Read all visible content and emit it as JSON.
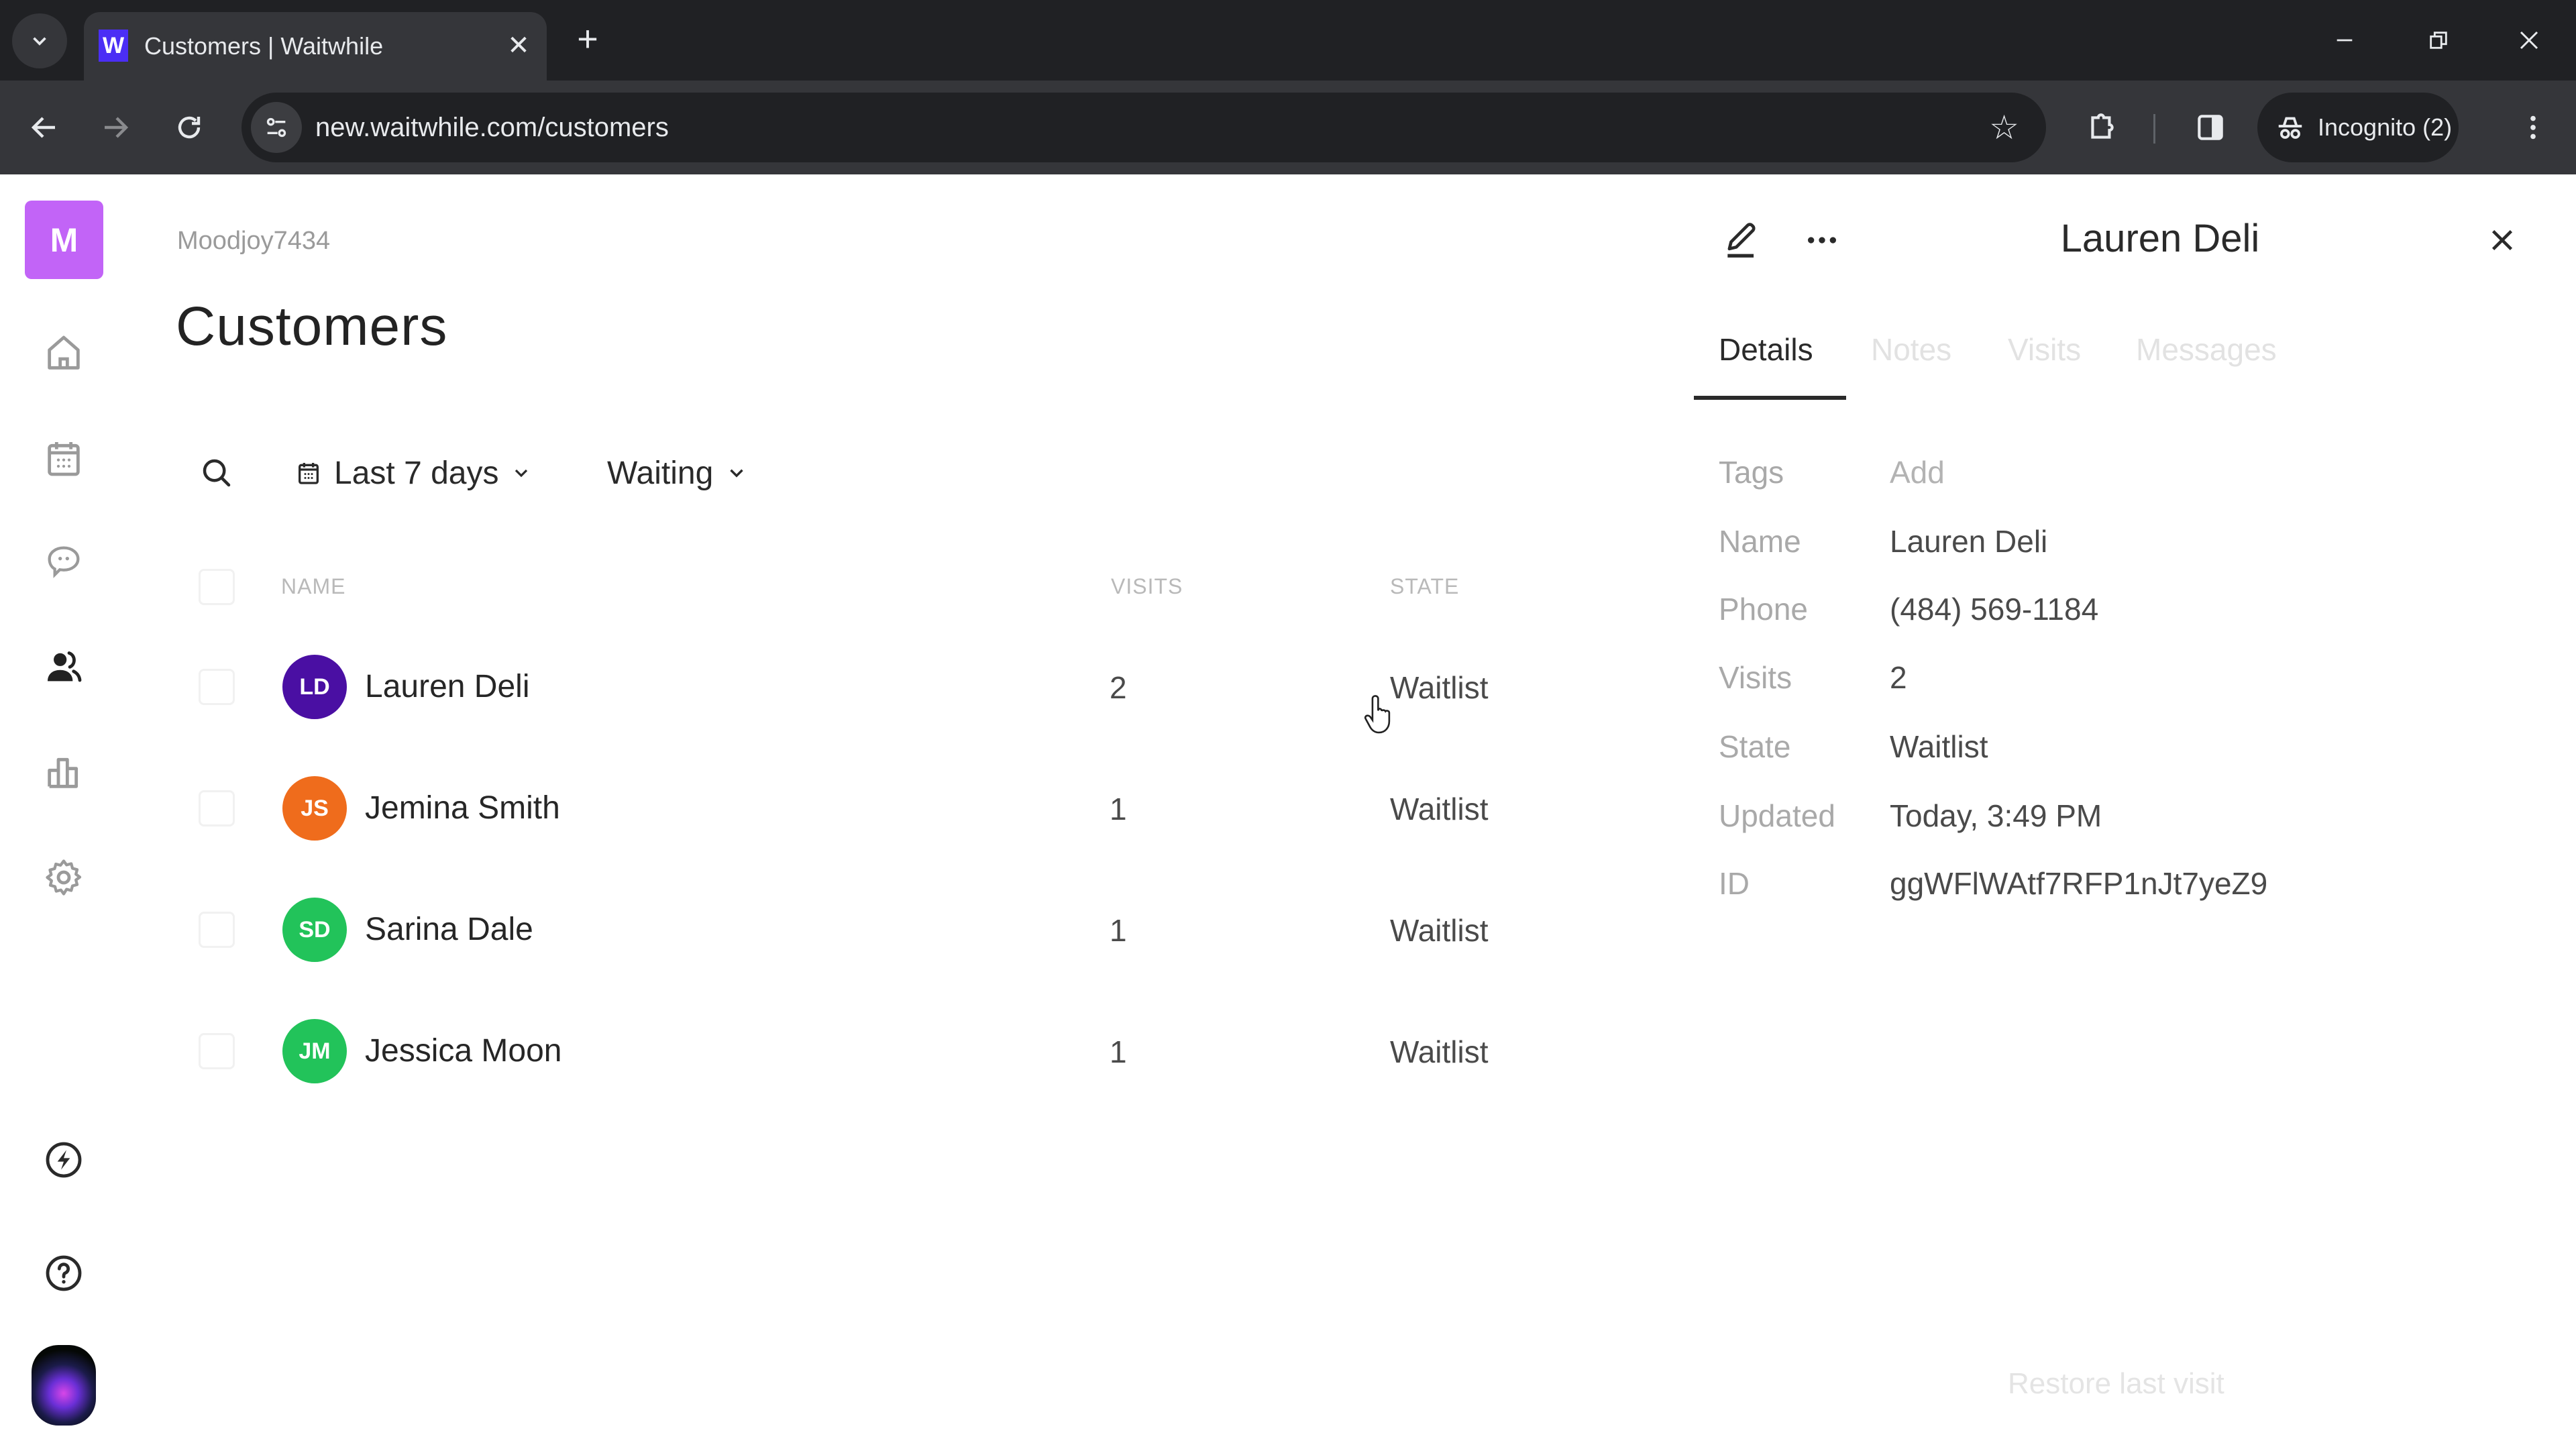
{
  "browser": {
    "tab_title": "Customers | Waitwhile",
    "favicon_letter": "W",
    "url": "new.waitwhile.com/customers",
    "incognito_label": "Incognito (2)"
  },
  "sidebar": {
    "org_initial": "M",
    "items": [
      {
        "name": "home",
        "icon": "home-icon"
      },
      {
        "name": "calendar",
        "icon": "calendar-icon"
      },
      {
        "name": "messages",
        "icon": "chat-icon"
      },
      {
        "name": "customers",
        "icon": "users-icon",
        "active": true
      },
      {
        "name": "analytics",
        "icon": "bar-chart-icon"
      },
      {
        "name": "settings",
        "icon": "gear-icon"
      }
    ],
    "bottom": [
      {
        "name": "whats-new",
        "icon": "lightning-icon"
      },
      {
        "name": "help",
        "icon": "help-icon"
      }
    ]
  },
  "main": {
    "breadcrumb": "Moodjoy7434",
    "title": "Customers",
    "filters": {
      "date_range": "Last 7 days",
      "state": "Waiting"
    },
    "table": {
      "columns": [
        "NAME",
        "VISITS",
        "STATE"
      ],
      "rows": [
        {
          "initials": "LD",
          "name": "Lauren Deli",
          "visits": "2",
          "state": "Waitlist",
          "color": "#4a0fa3"
        },
        {
          "initials": "JS",
          "name": "Jemina Smith",
          "visits": "1",
          "state": "Waitlist",
          "color": "#ef6c1c"
        },
        {
          "initials": "SD",
          "name": "Sarina Dale",
          "visits": "1",
          "state": "Waitlist",
          "color": "#22c35a"
        },
        {
          "initials": "JM",
          "name": "Jessica Moon",
          "visits": "1",
          "state": "Waitlist",
          "color": "#22c35a"
        }
      ]
    }
  },
  "panel": {
    "title": "Lauren Deli",
    "tabs": [
      "Details",
      "Notes",
      "Visits",
      "Messages"
    ],
    "active_tab": "Details",
    "details": [
      {
        "label": "Tags",
        "value": "Add",
        "muted": true
      },
      {
        "label": "Name",
        "value": "Lauren Deli"
      },
      {
        "label": "Phone",
        "value": "(484) 569-1184"
      },
      {
        "label": "Visits",
        "value": "2"
      },
      {
        "label": "State",
        "value": "Waitlist"
      },
      {
        "label": "Updated",
        "value": "Today, 3:49 PM"
      },
      {
        "label": "ID",
        "value": "ggWFlWAtf7RFP1nJt7yeZ9"
      }
    ],
    "restore_label": "Restore last visit"
  },
  "colors": {
    "brand_logo": "#c264f7",
    "favicon": "#4b2ef5"
  }
}
